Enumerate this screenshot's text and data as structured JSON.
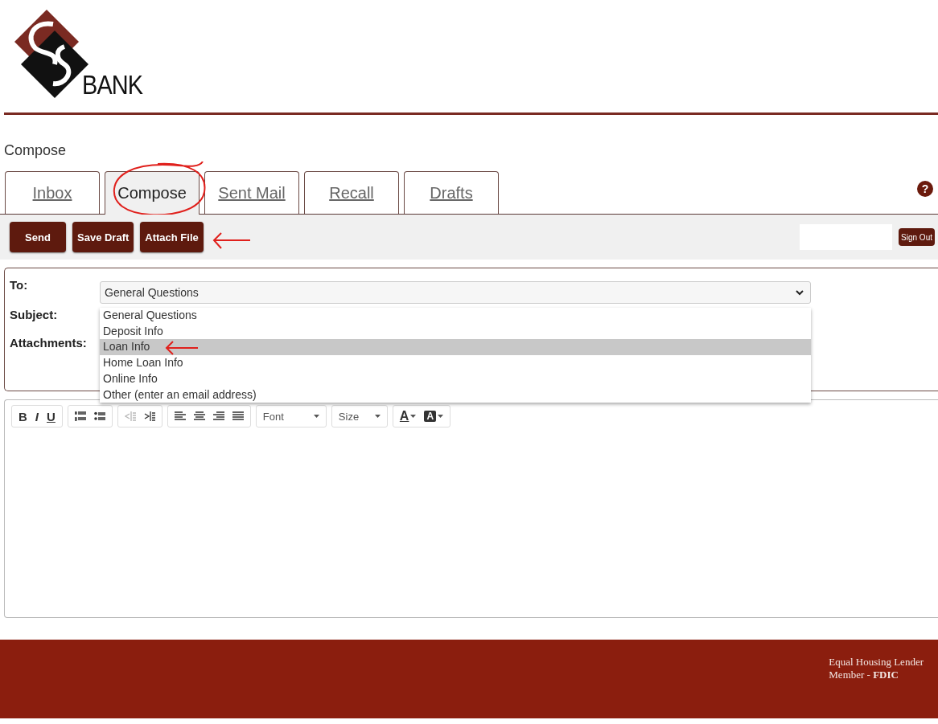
{
  "logo": {
    "text": "BANK"
  },
  "page_title": "Compose",
  "tabs": [
    {
      "label": "Inbox",
      "selected": false
    },
    {
      "label": "Compose",
      "selected": true
    },
    {
      "label": "Sent Mail",
      "selected": false
    },
    {
      "label": "Recall",
      "selected": false
    },
    {
      "label": "Drafts",
      "selected": false
    }
  ],
  "help": {
    "label": "?"
  },
  "actions": [
    "Send",
    "Save Draft",
    "Attach File"
  ],
  "sign_out": {
    "label": "Sign Out"
  },
  "form": {
    "fields": [
      {
        "label": "To:"
      },
      {
        "label": "Subject:"
      },
      {
        "label": "Attachments:"
      }
    ],
    "to_select": {
      "value": "General Questions",
      "options": [
        {
          "label": "General Questions",
          "highlighted": false
        },
        {
          "label": "Deposit Info",
          "highlighted": false
        },
        {
          "label": "Loan Info",
          "highlighted": true
        },
        {
          "label": "Home Loan Info",
          "highlighted": false
        },
        {
          "label": "Online Info",
          "highlighted": false
        },
        {
          "label": "Other (enter an email address)",
          "highlighted": false
        }
      ]
    }
  },
  "editor": {
    "format": [
      "B",
      "I",
      "U"
    ],
    "indent": [
      {
        "disabled": true
      },
      {
        "disabled": false
      }
    ],
    "font": "Font",
    "size": "Size",
    "text_color": "A",
    "highlight_color": "A"
  },
  "footer": {
    "line1": "Equal Housing Lender",
    "line2": "Member - **FDIC**"
  }
}
